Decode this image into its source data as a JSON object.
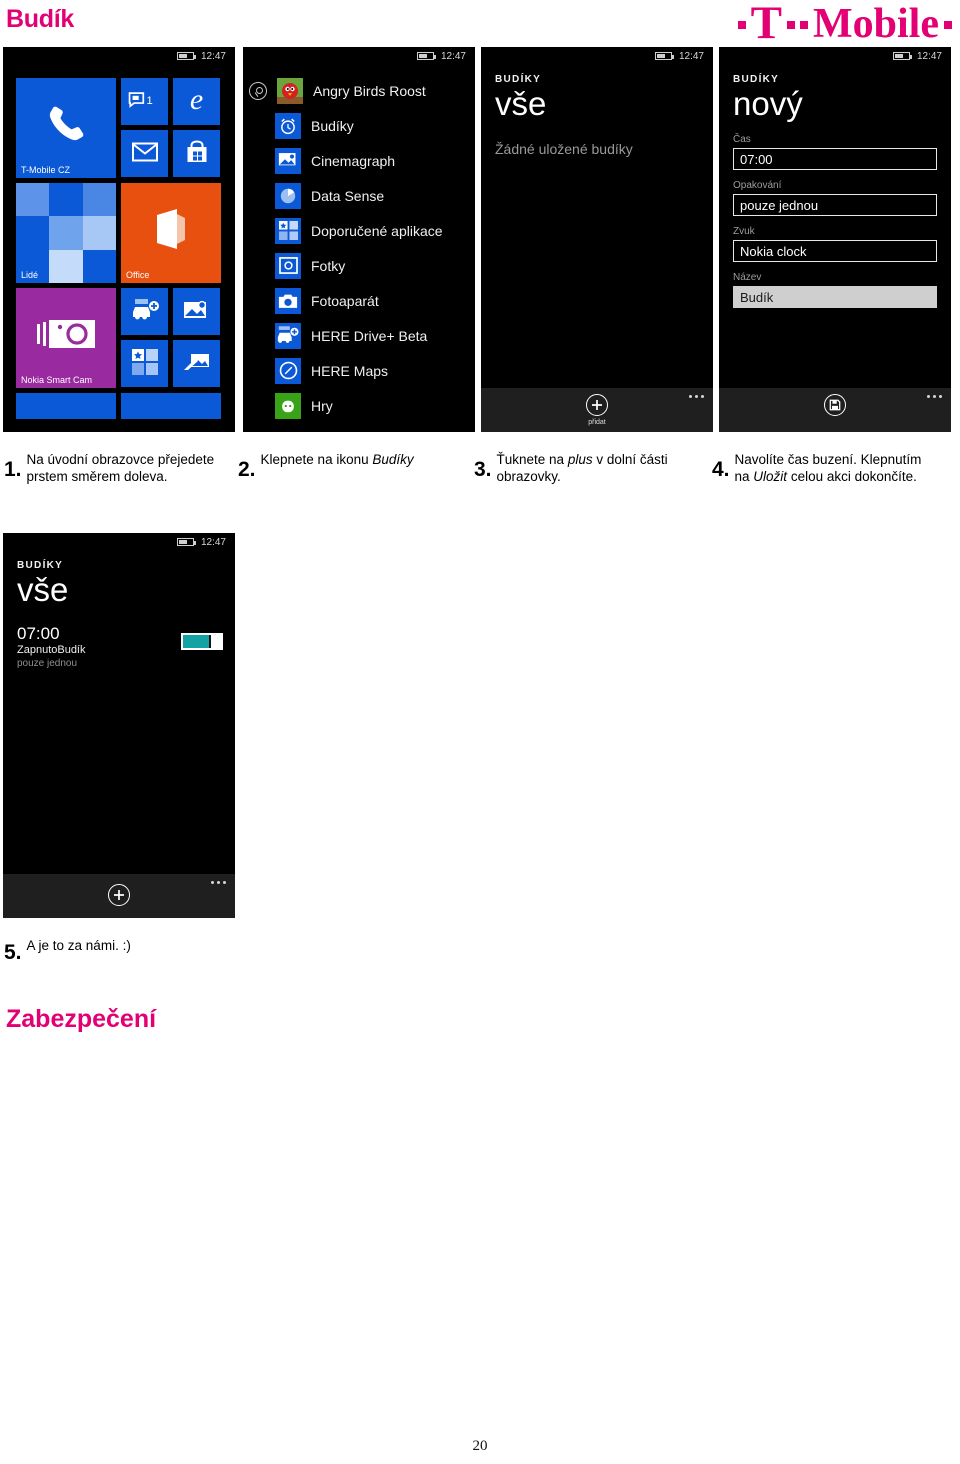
{
  "document": {
    "title": "Budík",
    "page_number": "20",
    "section_heading": "Zabezpečení",
    "brand": {
      "name": "T-Mobile",
      "letter": "T",
      "word": "Mobile",
      "color": "#e20074"
    }
  },
  "status_bar": {
    "time": "12:47",
    "battery_icon": "battery-icon"
  },
  "steps": [
    {
      "number": "1.",
      "text_html": "Na úvodní obrazovce přejedete prstem směrem doleva."
    },
    {
      "number": "2.",
      "text_html": "Klepnete na ikonu <i>Budíky</i>"
    },
    {
      "number": "3.",
      "text_html": "Ťuknete na <i>plus</i> v dolní části obrazovky."
    },
    {
      "number": "4.",
      "text_html": "Navolíte čas buzení. Klepnutím na <i>Uložit</i> celou akci dokončíte."
    },
    {
      "number": "5.",
      "text_html": "A je to za námi. :)"
    }
  ],
  "screen_start": {
    "tiles": [
      {
        "label": "T-Mobile CZ",
        "icon": "phone-icon",
        "color": "#0b59d6",
        "size": "big"
      },
      {
        "label": "",
        "icon": "messaging-icon",
        "badge": "1",
        "color": "#0b59d6",
        "size": "small"
      },
      {
        "label": "",
        "icon": "internet-explorer-icon",
        "color": "#0b59d6",
        "size": "small"
      },
      {
        "label": "",
        "icon": "mail-icon",
        "color": "#0b59d6",
        "size": "small"
      },
      {
        "label": "",
        "icon": "store-icon",
        "color": "#0b59d6",
        "size": "small"
      },
      {
        "label": "Lidé",
        "icon": "people-mosaic-icon",
        "color": "#0b59d6",
        "size": "big"
      },
      {
        "label": "Office",
        "icon": "office-icon",
        "color": "#e8500f",
        "size": "big"
      },
      {
        "label": "Nokia Smart Cam",
        "icon": "camera-icon",
        "color": "#9a2aa0",
        "size": "big"
      },
      {
        "label": "",
        "icon": "here-drive-icon",
        "color": "#0b59d6",
        "size": "small"
      },
      {
        "label": "",
        "icon": "photo-edit-icon",
        "color": "#0b59d6",
        "size": "small"
      },
      {
        "label": "",
        "icon": "apps-grid-icon",
        "color": "#0b59d6",
        "size": "small"
      },
      {
        "label": "",
        "icon": "share-photo-icon",
        "color": "#0b59d6",
        "size": "small"
      }
    ]
  },
  "screen_applist": {
    "search_icon": "search-icon",
    "apps": [
      {
        "name": "Angry Birds Roost",
        "icon": "angry-birds-icon",
        "color": "#3b7a12"
      },
      {
        "name": "Budíky",
        "icon": "alarm-clock-icon",
        "color": "#0b59d6"
      },
      {
        "name": "Cinemagraph",
        "icon": "cinemagraph-icon",
        "color": "#0b59d6"
      },
      {
        "name": "Data Sense",
        "icon": "data-sense-icon",
        "color": "#0b59d6"
      },
      {
        "name": "Doporučené aplikace",
        "icon": "recommended-apps-icon",
        "color": "#0b59d6"
      },
      {
        "name": "Fotky",
        "icon": "photos-icon",
        "color": "#0b59d6"
      },
      {
        "name": "Fotoaparát",
        "icon": "camera-app-icon",
        "color": "#0b59d6"
      },
      {
        "name": "HERE Drive+ Beta",
        "icon": "here-drive-icon",
        "color": "#0b59d6"
      },
      {
        "name": "HERE Maps",
        "icon": "here-maps-icon",
        "color": "#0b59d6"
      },
      {
        "name": "Hry",
        "icon": "xbox-games-icon",
        "color": "#38a318"
      }
    ]
  },
  "screen_alarms_empty": {
    "app_name": "BUDÍKY",
    "page_title": "vše",
    "empty_message": "Žádné uložené budíky",
    "appbar": {
      "add_icon": "plus-icon",
      "add_label": "přidat",
      "more_icon": "ellipsis-icon"
    }
  },
  "screen_new_alarm": {
    "app_name": "BUDÍKY",
    "page_title": "nový",
    "fields": [
      {
        "label": "Čas",
        "value": "07:00",
        "filled": false
      },
      {
        "label": "Opakování",
        "value": "pouze jednou",
        "filled": false
      },
      {
        "label": "Zvuk",
        "value": "Nokia clock",
        "filled": false
      },
      {
        "label": "Název",
        "value": "Budík",
        "filled": true
      }
    ],
    "appbar": {
      "save_icon": "save-icon",
      "more_icon": "ellipsis-icon"
    }
  },
  "screen_alarms_saved": {
    "app_name": "BUDÍKY",
    "page_title": "vše",
    "alarm": {
      "time": "07:00",
      "state": "ZapnutoBudík",
      "repeat": "pouze jednou",
      "toggle_on": true,
      "toggle_color": "#13a3a3"
    },
    "appbar": {
      "add_icon": "plus-icon",
      "more_icon": "ellipsis-icon"
    }
  }
}
